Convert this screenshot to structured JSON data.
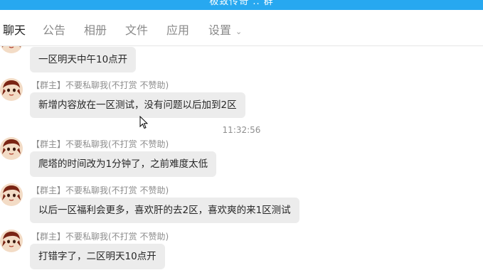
{
  "window": {
    "title": "极致传奇 .. 群"
  },
  "tabs": [
    {
      "label": "聊天",
      "active": true
    },
    {
      "label": "公告"
    },
    {
      "label": "相册"
    },
    {
      "label": "文件"
    },
    {
      "label": "应用"
    },
    {
      "label": "设置"
    }
  ],
  "messages": [
    {
      "text": "一区明天中午10点开"
    },
    {
      "sender": "【群主】不要私聊我(不打赏 不赞助)",
      "text": "新增内容放在一区测试，没有问题以后加到2区"
    },
    {
      "timestamp": "11:32:56"
    },
    {
      "sender": "【群主】不要私聊我(不打赏 不赞助)",
      "text": "爬塔的时间改为1分钟了，之前难度太低"
    },
    {
      "sender": "【群主】不要私聊我(不打赏 不赞助)",
      "text": "以后一区福利会更多，喜欢肝的去2区，喜欢爽的来1区测试"
    },
    {
      "sender": "【群主】不要私聊我(不打赏 不赞助)",
      "text": "打错字了，二区明天10点开"
    }
  ],
  "colors": {
    "accent": "#27a8f0",
    "bubble": "#ececec"
  }
}
